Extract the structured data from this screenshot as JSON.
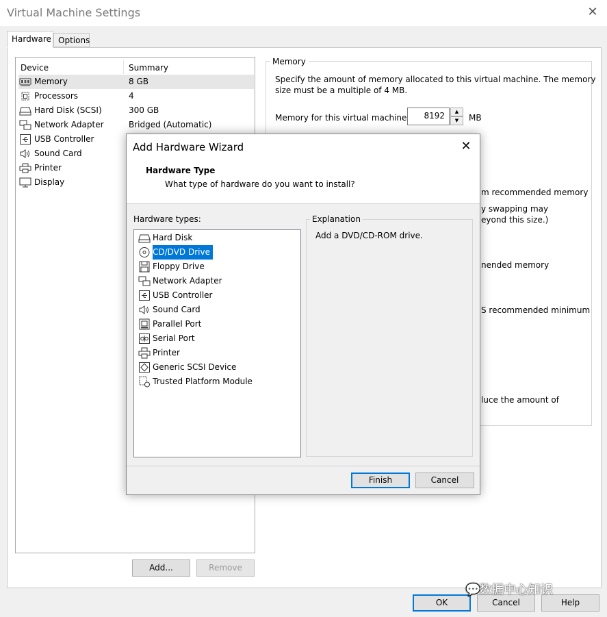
{
  "window": {
    "title": "Virtual Machine Settings"
  },
  "tabs": [
    {
      "label": "Hardware"
    },
    {
      "label": "Options"
    }
  ],
  "device_list": {
    "col_device": "Device",
    "col_summary": "Summary",
    "rows": [
      {
        "name": "Memory",
        "summary": "8 GB",
        "icon": "memory-icon"
      },
      {
        "name": "Processors",
        "summary": "4",
        "icon": "processor-icon"
      },
      {
        "name": "Hard Disk (SCSI)",
        "summary": "300 GB",
        "icon": "hard-disk-icon"
      },
      {
        "name": "Network Adapter",
        "summary": "Bridged (Automatic)",
        "icon": "network-adapter-icon"
      },
      {
        "name": "USB Controller",
        "summary": "",
        "icon": "usb-controller-icon"
      },
      {
        "name": "Sound Card",
        "summary": "",
        "icon": "sound-card-icon"
      },
      {
        "name": "Printer",
        "summary": "",
        "icon": "printer-icon"
      },
      {
        "name": "Display",
        "summary": "",
        "icon": "display-icon"
      }
    ]
  },
  "buttons": {
    "add": "Add...",
    "remove": "Remove",
    "ok": "OK",
    "cancel": "Cancel",
    "help": "Help"
  },
  "memory": {
    "legend": "Memory",
    "desc1": "Specify the amount of memory allocated to this virtual machine. The memory",
    "desc2": "size must be a multiple of 4 MB.",
    "field_label": "Memory for this virtual machine:",
    "value": "8192",
    "unit": "MB",
    "frag1": "m recommended memory",
    "frag2": "y swapping may",
    "frag3": "eyond this size.)",
    "frag4": "nended memory",
    "frag5": "S recommended minimum",
    "frag6": "luce the amount of"
  },
  "watermark": "数据中心知识",
  "dialog": {
    "title": "Add Hardware Wizard",
    "heading": "Hardware Type",
    "question": "What type of hardware do you want to install?",
    "types_label": "Hardware types:",
    "explanation_legend": "Explanation",
    "explanation_text": "Add a DVD/CD-ROM drive.",
    "finish": "Finish",
    "cancel": "Cancel",
    "hardware_types": [
      {
        "name": "Hard Disk",
        "icon": "hard-disk-icon"
      },
      {
        "name": "CD/DVD Drive",
        "icon": "cd-dvd-icon"
      },
      {
        "name": "Floppy Drive",
        "icon": "floppy-icon"
      },
      {
        "name": "Network Adapter",
        "icon": "network-adapter-icon"
      },
      {
        "name": "USB Controller",
        "icon": "usb-controller-icon"
      },
      {
        "name": "Sound Card",
        "icon": "sound-card-icon"
      },
      {
        "name": "Parallel Port",
        "icon": "parallel-port-icon"
      },
      {
        "name": "Serial Port",
        "icon": "serial-port-icon"
      },
      {
        "name": "Printer",
        "icon": "printer-icon"
      },
      {
        "name": "Generic SCSI Device",
        "icon": "scsi-device-icon"
      },
      {
        "name": "Trusted Platform Module",
        "icon": "tpm-icon"
      }
    ]
  },
  "colors": {
    "selection": "#0078d7",
    "default_button_border": "#0078d7"
  }
}
